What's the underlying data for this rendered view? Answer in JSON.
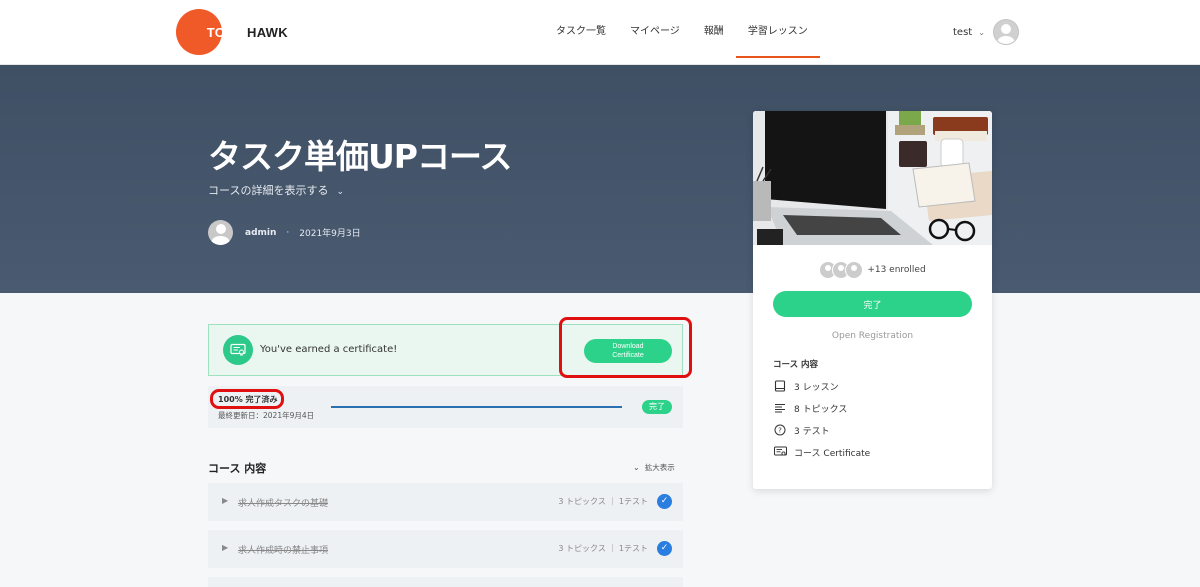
{
  "header": {
    "logo_left": "TOMA",
    "logo_right": "HAWK",
    "nav": [
      {
        "label": "タスク一覧"
      },
      {
        "label": "マイページ"
      },
      {
        "label": "報酬"
      },
      {
        "label": "学習レッスン",
        "active": true
      }
    ],
    "user_name": "test"
  },
  "hero": {
    "title": "タスク単価UPコース",
    "details_toggle": "コースの詳細を表示する",
    "author": "admin",
    "date": "2021年9月3日"
  },
  "certificate": {
    "message": "You've earned a certificate!",
    "button_line1": "Download",
    "button_line2": "Certificate"
  },
  "progress": {
    "percent_label": "100% 完了済み",
    "percent": 100,
    "updated": "最終更新日：2021年9月4日",
    "badge": "完了"
  },
  "course_content": {
    "title": "コース 内容",
    "expand_label": "拡大表示",
    "lessons": [
      {
        "name": "求人作成タスクの基礎",
        "meta": "3 トピックス ｜ 1テスト",
        "completed": true
      },
      {
        "name": "求人作成時の禁止事項",
        "meta": "3 トピックス ｜ 1テスト",
        "completed": true
      }
    ]
  },
  "sidebar": {
    "enrolled": "+13 enrolled",
    "status_button": "完了",
    "registration": "Open Registration",
    "includes_title": "コース 内容",
    "includes": [
      {
        "icon": "book-icon",
        "label": "3 レッスン"
      },
      {
        "icon": "topics-icon",
        "label": "8 トピックス"
      },
      {
        "icon": "quiz-icon",
        "label": "3 テスト"
      },
      {
        "icon": "certificate-icon",
        "label": "コース Certificate"
      }
    ]
  },
  "colors": {
    "accent_orange": "#f05a28",
    "green": "#2cd289",
    "hero_bg": "#44556b",
    "check_blue": "#2a7ee0",
    "highlight_red": "#e01010"
  }
}
